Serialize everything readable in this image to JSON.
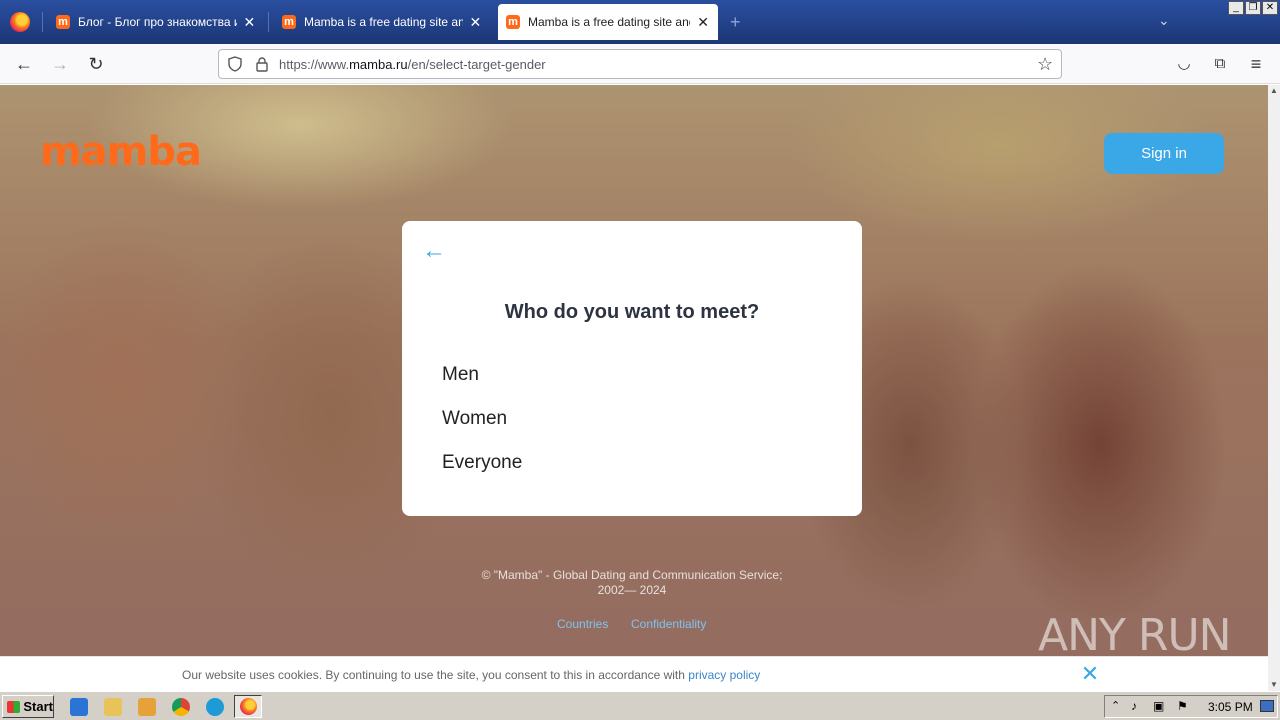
{
  "browser": {
    "tabs": [
      {
        "title": "Блог - Блог про знакомства и отн",
        "favicon": "m",
        "active": false
      },
      {
        "title": "Mamba is a free dating site and a c",
        "favicon": "m",
        "active": false
      },
      {
        "title": "Mamba is a free dating site and a c",
        "favicon": "m",
        "active": true
      }
    ],
    "new_tab_icon": "+",
    "url_prefix": "https://www.",
    "url_host": "mamba.ru",
    "url_path": "/en/select-target-gender"
  },
  "page": {
    "logo": "mamba",
    "signin_label": "Sign in",
    "card": {
      "back_icon": "←",
      "question": "Who do you want to meet?",
      "options": [
        "Men",
        "Women",
        "Everyone"
      ]
    },
    "footer": {
      "copyright_line1": "© \"Mamba\" - Global Dating and Communication Service;",
      "copyright_line2": "2002— 2024",
      "links": [
        "Countries",
        "Confidentiality"
      ]
    },
    "watermark": "ANY RUN"
  },
  "cookie_bar": {
    "text": "Our website uses cookies. By continuing to use the site, you consent to this in accordance with ",
    "link": "privacy policy",
    "close_icon": "✕"
  },
  "taskbar": {
    "start_label": "Start",
    "clock": "3:05 PM"
  },
  "colors": {
    "brand": "#ff6a1a",
    "accent": "#3aa7e6",
    "tabstrip": "#1f3b7a"
  }
}
